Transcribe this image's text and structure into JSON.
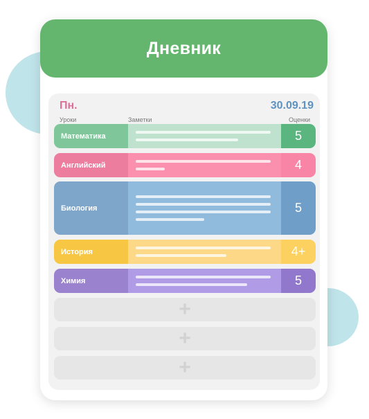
{
  "header": {
    "title": "Дневник"
  },
  "day": {
    "label": "Пн.",
    "date": "30.09.19"
  },
  "columns": {
    "lessons": "Уроки",
    "notes": "Заметки",
    "grades": "Оценки"
  },
  "lessons": [
    {
      "subject": "Математика",
      "grade": "5",
      "note_line_count": 2,
      "colors": {
        "subject": "#7fc79a",
        "notes": "#bfe2cf",
        "grade": "#5ab57f"
      }
    },
    {
      "subject": "Английский",
      "grade": "4",
      "note_line_count": 2,
      "colors": {
        "subject": "#ec7d9e",
        "notes": "#fb8fae",
        "grade": "#f985a6"
      }
    },
    {
      "subject": "Биология",
      "grade": "5",
      "note_line_count": 4,
      "colors": {
        "subject": "#7ea6cb",
        "notes": "#90bbdd",
        "grade": "#6f9fc8"
      }
    },
    {
      "subject": "История",
      "grade": "4+",
      "note_line_count": 2,
      "colors": {
        "subject": "#f7c744",
        "notes": "#fdd987",
        "grade": "#fcd160"
      }
    },
    {
      "subject": "Химия",
      "grade": "5",
      "note_line_count": 2,
      "colors": {
        "subject": "#9a82cf",
        "notes": "#b09be6",
        "grade": "#9178cd"
      }
    }
  ],
  "empty_slots": [
    {
      "icon": "plus-icon",
      "symbol": "+"
    },
    {
      "icon": "plus-icon",
      "symbol": "+"
    },
    {
      "icon": "plus-icon",
      "symbol": "+"
    }
  ],
  "colors": {
    "header": "#64b66e",
    "day": "#dc6f98",
    "date": "#5e92c0"
  }
}
